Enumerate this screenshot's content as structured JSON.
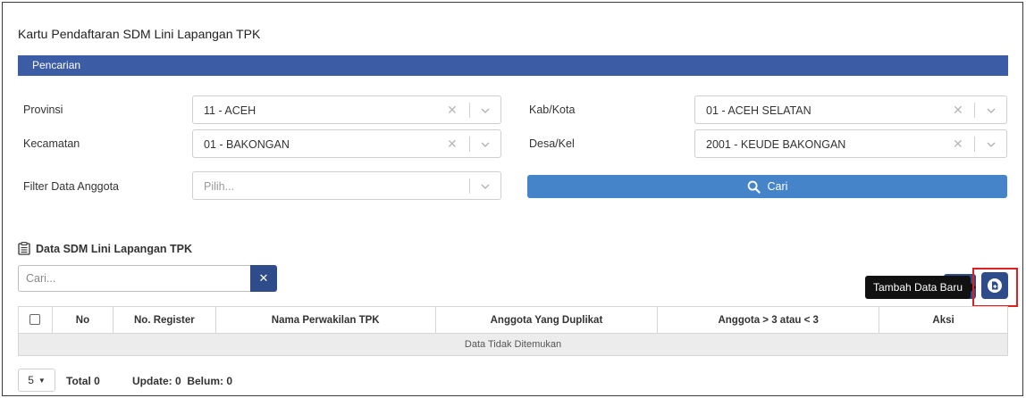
{
  "page": {
    "title": "Kartu Pendaftaran SDM Lini Lapangan TPK"
  },
  "search_panel": {
    "header": "Pencarian",
    "fields": {
      "provinsi": {
        "label": "Provinsi",
        "value": "11 - ACEH"
      },
      "kabkota": {
        "label": "Kab/Kota",
        "value": "01 - ACEH SELATAN"
      },
      "kecamatan": {
        "label": "Kecamatan",
        "value": "01 - BAKONGAN"
      },
      "desakel": {
        "label": "Desa/Kel",
        "value": "2001 - KEUDE BAKONGAN"
      },
      "filter": {
        "label": "Filter Data Anggota",
        "placeholder": "Pilih..."
      }
    },
    "search_button": "Cari"
  },
  "data_section": {
    "title": "Data SDM Lini Lapangan TPK",
    "search_placeholder": "Cari...",
    "add_tooltip": "Tambah Data Baru",
    "table": {
      "columns": [
        "No",
        "No. Register",
        "Nama Perwakilan TPK",
        "Anggota Yang Duplikat",
        "Anggota > 3 atau < 3",
        "Aksi"
      ],
      "empty_message": "Data Tidak Ditemukan"
    }
  },
  "footer": {
    "page_size": "5",
    "total": "Total 0",
    "status": "Update: 0  Belum: 0"
  },
  "colors": {
    "header_bar": "#3c5da6",
    "primary_button": "#4584c9",
    "dark_button": "#2e4b8a",
    "highlight": "#e02020"
  }
}
